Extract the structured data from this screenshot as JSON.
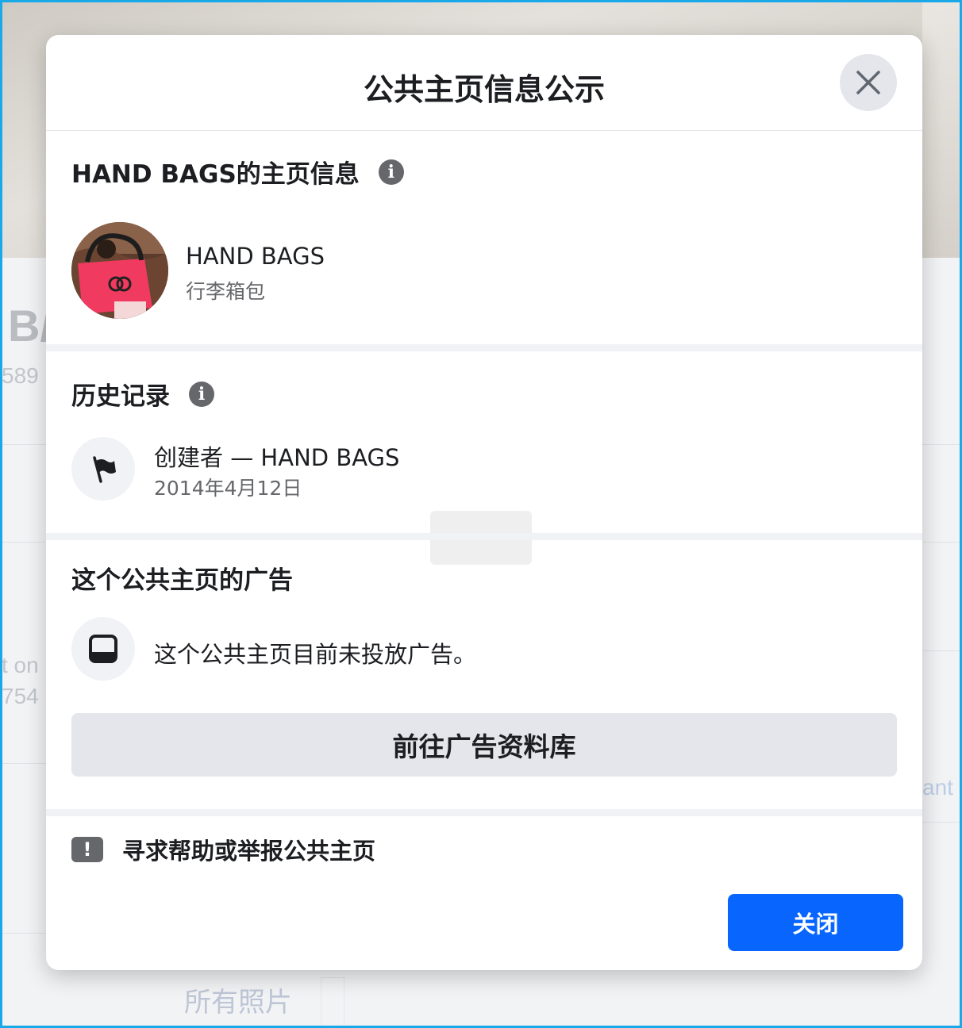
{
  "background": {
    "page_name_fragment": "B/",
    "stat_fragment": "589 (",
    "left_text_1": "t on",
    "left_text_2": "754",
    "right_text": "ant",
    "photos_tab": "所有照片"
  },
  "dialog": {
    "title": "公共主页信息公示",
    "page_info": {
      "heading": "HAND BAGS的主页信息",
      "info_icon": "i",
      "page_name": "HAND BAGS",
      "category": "行李箱包"
    },
    "history": {
      "heading": "历史记录",
      "info_icon": "i",
      "item_title": "创建者 — HAND BAGS",
      "item_date": "2014年4月12日"
    },
    "ads": {
      "heading": "这个公共主页的广告",
      "status_text": "这个公共主页目前未投放广告。",
      "library_button": "前往广告资料库"
    },
    "report": {
      "badge": "!",
      "label": "寻求帮助或举报公共主页"
    },
    "close_button": "关闭"
  },
  "colors": {
    "primary": "#0866ff",
    "frame": "#19a9e8",
    "avatar_bag": "#f03a5f"
  }
}
